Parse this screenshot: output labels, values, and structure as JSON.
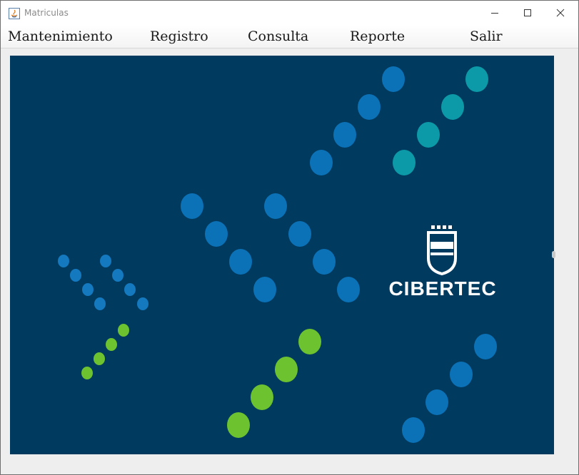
{
  "window": {
    "title": "Matriculas",
    "controls": {
      "minimize": "—",
      "maximize": "☐",
      "close": "✕"
    }
  },
  "menu": [
    {
      "label": "Mantenimiento"
    },
    {
      "label": "Registro"
    },
    {
      "label": "Consulta"
    },
    {
      "label": "Reporte"
    },
    {
      "label": "Salir"
    }
  ],
  "banner": {
    "logo_text": "CIBERTEC",
    "colors": {
      "background": "#013a5f",
      "blue_dots": "#0b72b8",
      "small_blue_dots": "#1479bf",
      "teal_dots": "#0d9aa8",
      "green_dots": "#6cc22f",
      "logo": "#ffffff"
    }
  }
}
